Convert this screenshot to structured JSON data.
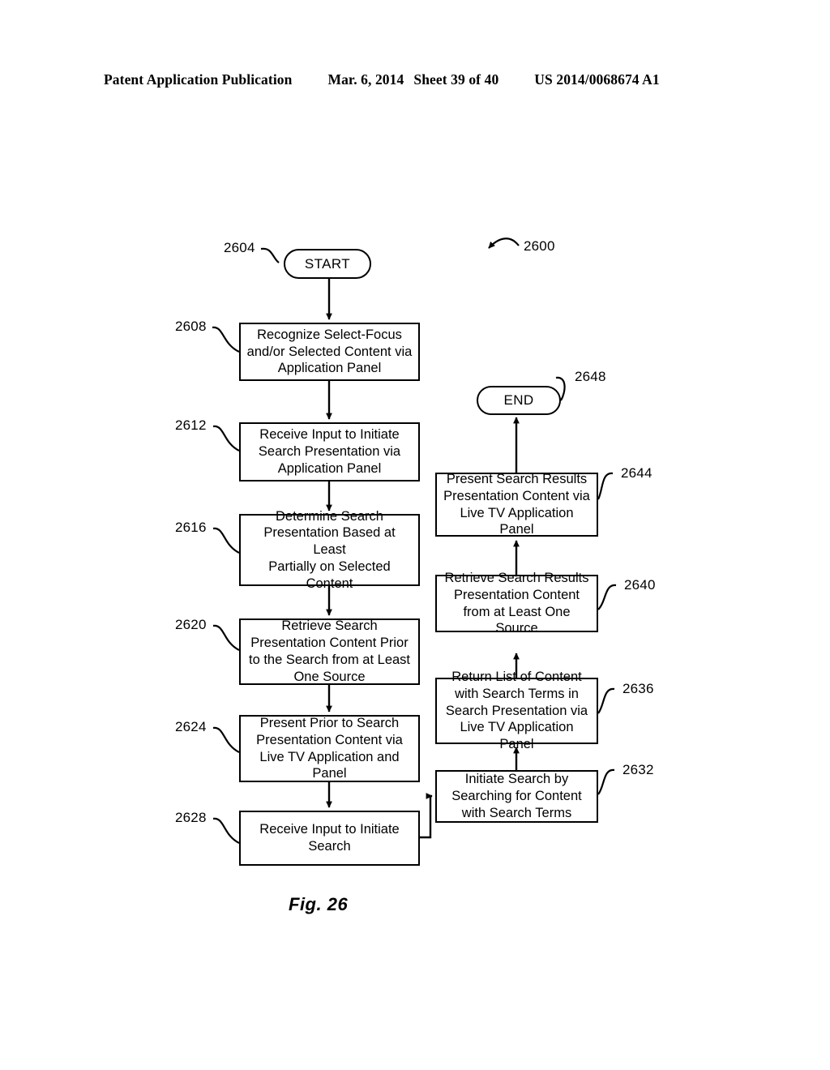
{
  "header": {
    "publication": "Patent Application Publication",
    "date": "Mar. 6, 2014",
    "sheet": "Sheet 39 of 40",
    "patent_number": "US 2014/0068674 A1"
  },
  "figure": {
    "caption": "Fig. 26",
    "diagram_label": "2600"
  },
  "nodes": {
    "start": {
      "ref": "2604",
      "label": "START"
    },
    "n2608": {
      "ref": "2608",
      "label": "Recognize Select-Focus\nand/or Selected Content via\nApplication Panel"
    },
    "n2612": {
      "ref": "2612",
      "label": "Receive Input to Initiate\nSearch Presentation via\nApplication Panel"
    },
    "n2616": {
      "ref": "2616",
      "label": "Determine Search\nPresentation Based at Least\nPartially on Selected\nContent"
    },
    "n2620": {
      "ref": "2620",
      "label": "Retrieve Search\nPresentation Content Prior\nto the Search from at Least\nOne Source"
    },
    "n2624": {
      "ref": "2624",
      "label": "Present Prior to Search\nPresentation Content via\nLive TV Application and\nPanel"
    },
    "n2628": {
      "ref": "2628",
      "label": "Receive Input to Initiate\nSearch"
    },
    "n2632": {
      "ref": "2632",
      "label": "Initiate Search by\nSearching for Content\nwith Search Terms"
    },
    "n2636": {
      "ref": "2636",
      "label": "Return List of Content\nwith Search Terms in\nSearch Presentation via\nLive TV Application Panel"
    },
    "n2640": {
      "ref": "2640",
      "label": "Retrieve Search Results\nPresentation Content\nfrom at Least One Source"
    },
    "n2644": {
      "ref": "2644",
      "label": "Present Search Results\nPresentation Content via\nLive TV Application Panel"
    },
    "end": {
      "ref": "2648",
      "label": "END"
    }
  }
}
